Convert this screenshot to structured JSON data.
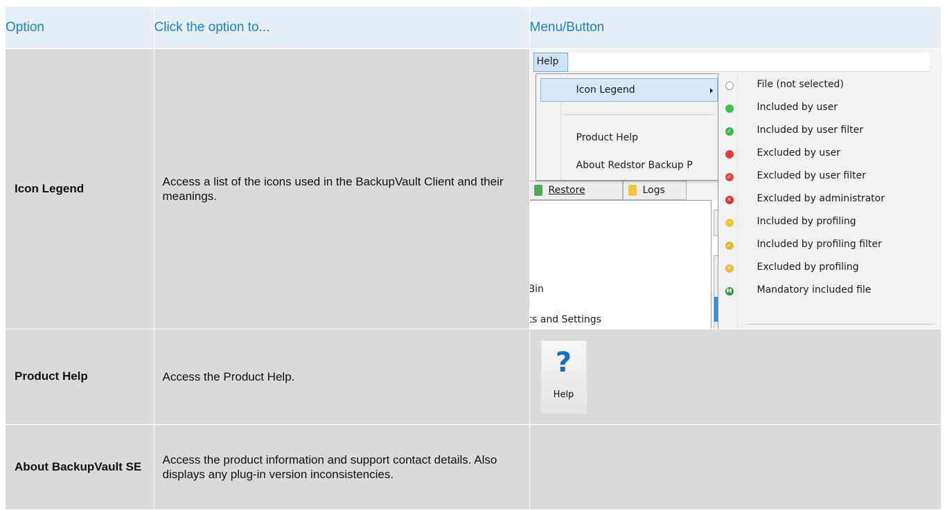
{
  "table": {
    "headers": [
      "Option",
      "Click the option to...",
      "Menu/Button"
    ],
    "rows": [
      {
        "option": "Icon Legend",
        "description": "Access a list of the icons used in the BackupVault Client and their meanings."
      },
      {
        "option": "Product Help",
        "description": "Access the Product Help."
      },
      {
        "option": "About BackupVault SE",
        "description": "Access the product information and support contact details. Also displays any plug-in version inconsistencies."
      }
    ]
  },
  "screenshot": {
    "menu_label": "Help",
    "dropdown_items": [
      "Icon Legend",
      "Product Help",
      "About Redstor Backup P"
    ],
    "tabs": [
      "Restore",
      "Logs"
    ],
    "tree_items": [
      "Bin",
      "i",
      "ts and Settings"
    ],
    "legend": [
      {
        "label": "File (not selected)",
        "color": "#ffffff",
        "icon": "empty-circle-icon"
      },
      {
        "label": "Included by user",
        "color": "#3cc24a",
        "icon": "green-circle-icon"
      },
      {
        "label": "Included by user filter",
        "color": "#3cb44a",
        "icon": "green-check-icon"
      },
      {
        "label": "Excluded by user",
        "color": "#e43b3b",
        "icon": "red-circle-icon"
      },
      {
        "label": "Excluded by user filter",
        "color": "#d94a4a",
        "icon": "red-check-icon"
      },
      {
        "label": "Excluded by administrator",
        "color": "#d93030",
        "icon": "red-x-icon"
      },
      {
        "label": "Included by profiling",
        "color": "#f0c53a",
        "icon": "yellow-circle-icon"
      },
      {
        "label": "Included by profiling filter",
        "color": "#e6b830",
        "icon": "yellow-check-icon"
      },
      {
        "label": "Excluded by profiling",
        "color": "#f0b43a",
        "icon": "yellow-x-icon"
      },
      {
        "label": "Mandatory included file",
        "color": "#2a9a3a",
        "icon": "mandatory-m-icon"
      }
    ],
    "help_button_label": "Help"
  }
}
